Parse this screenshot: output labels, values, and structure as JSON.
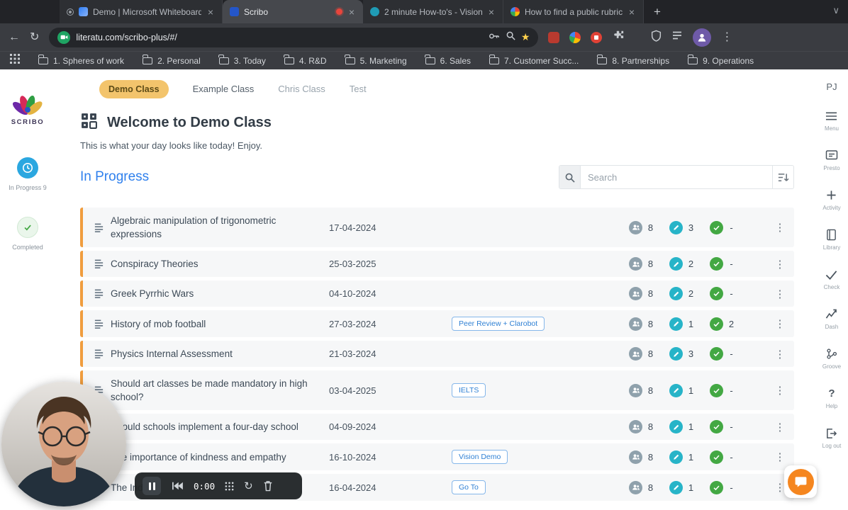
{
  "icons": {
    "close": "×",
    "new_tab": "+",
    "caret_down": "∨",
    "back": "←",
    "reload": "↻",
    "star": "★",
    "kebab": "⋮",
    "help": "?",
    "restart": "↻"
  },
  "browser": {
    "tabs": [
      {
        "label": "Demo | Microsoft Whiteboard"
      },
      {
        "label": "Scribo"
      },
      {
        "label": "2 minute How-to's - Vision"
      },
      {
        "label": "How to find a public rubric (e"
      }
    ],
    "url": "literatu.com/scribo-plus/#/",
    "bookmarks": [
      "1. Spheres of work",
      "2. Personal",
      "3. Today",
      "4. R&D",
      "5. Marketing",
      "6. Sales",
      "7. Customer Succ...",
      "8. Partnerships",
      "9. Operations"
    ]
  },
  "sidebar": {
    "logo": "SCRIBO",
    "in_progress": "In Progress 9",
    "completed": "Completed"
  },
  "class_tabs": [
    "Demo Class",
    "Example Class",
    "Chris Class",
    "Test"
  ],
  "header": {
    "title": "Welcome to Demo Class",
    "subtitle": "This is what your day looks like today! Enjoy."
  },
  "section": {
    "title": "In Progress"
  },
  "search": {
    "placeholder": "Search"
  },
  "assignments": [
    {
      "title": "Algebraic manipulation of trigonometric expressions",
      "date": "17-04-2024",
      "tag": "",
      "members": "8",
      "inreview": "3",
      "done": "-"
    },
    {
      "title": "Conspiracy Theories",
      "date": "25-03-2025",
      "tag": "",
      "members": "8",
      "inreview": "2",
      "done": "-"
    },
    {
      "title": "Greek Pyrrhic Wars",
      "date": "04-10-2024",
      "tag": "",
      "members": "8",
      "inreview": "2",
      "done": "-"
    },
    {
      "title": "History of mob football",
      "date": "27-03-2024",
      "tag": "Peer Review + Clarobot",
      "members": "8",
      "inreview": "1",
      "done": "2"
    },
    {
      "title": "Physics Internal Assessment",
      "date": "21-03-2024",
      "tag": "",
      "members": "8",
      "inreview": "3",
      "done": "-"
    },
    {
      "title": "Should art classes be made mandatory in high school?",
      "date": "03-04-2025",
      "tag": "IELTS",
      "members": "8",
      "inreview": "1",
      "done": "-"
    },
    {
      "title": "Should schools implement a four-day school",
      "date": "04-09-2024",
      "tag": "",
      "members": "8",
      "inreview": "1",
      "done": "-"
    },
    {
      "title": "The importance of kindness and empathy",
      "date": "16-10-2024",
      "tag": "Vision Demo",
      "members": "8",
      "inreview": "1",
      "done": "-"
    },
    {
      "title": "The Ind",
      "date": "16-04-2024",
      "tag": "Go To",
      "members": "8",
      "inreview": "1",
      "done": "-"
    }
  ],
  "rightbar": {
    "profile": "PJ",
    "items": [
      "Menu",
      "Presto",
      "Activity",
      "Library",
      "Check",
      "Dash",
      "Groove",
      "Help",
      "Log out"
    ]
  },
  "recorder": {
    "time": "0:00"
  },
  "colors": {
    "accent_orange": "#f09d3e",
    "link_blue": "#2f80ed",
    "badge_gray": "#8fa1ac",
    "badge_teal": "#27b4c8",
    "badge_green": "#43a843",
    "active_class_pill": "#f3c46c",
    "record_red": "#e8453c",
    "fab_orange": "#f5861f",
    "in_progress_circle": "#2ba7e0"
  }
}
